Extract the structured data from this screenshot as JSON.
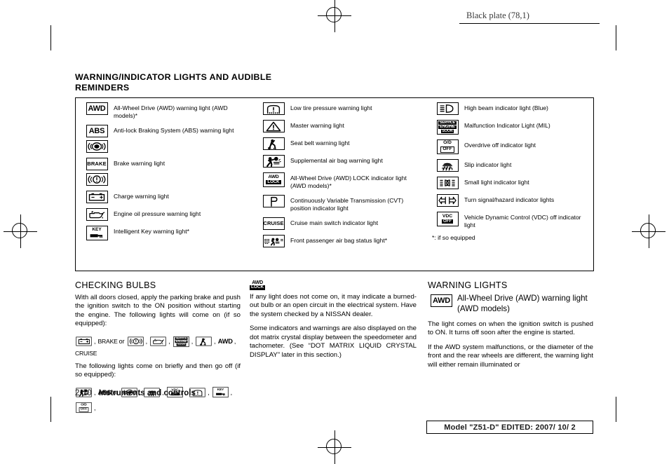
{
  "page": {
    "black_plate": "Black plate (78,1)",
    "model_footer": "Model \"Z51-D\"  EDITED:  2007/ 10/ 2",
    "page_number": "2-10",
    "section_name": "Instruments and controls",
    "title": "WARNING/INDICATOR LIGHTS AND AUDIBLE REMINDERS"
  },
  "indicator_table": {
    "footnote": "*: if so equipped",
    "columns": [
      {
        "rows": [
          {
            "icons": [
              "awd"
            ],
            "label": "All-Wheel Drive (AWD) warning light (AWD models)*"
          },
          {
            "icons": [
              "abs",
              "abs-circle"
            ],
            "label": "Anti-lock Braking System (ABS) warning light"
          },
          {
            "icons": [
              "brake",
              "brake-circle"
            ],
            "label": "Brake warning light"
          },
          {
            "icons": [
              "battery"
            ],
            "label": "Charge warning light"
          },
          {
            "icons": [
              "oil-can"
            ],
            "label": "Engine oil pressure warning light"
          },
          {
            "icons": [
              "key"
            ],
            "label": "Intelligent Key warning light*"
          }
        ]
      },
      {
        "rows": [
          {
            "icons": [
              "tire-pressure"
            ],
            "label": "Low tire pressure warning light"
          },
          {
            "icons": [
              "master-warning"
            ],
            "label": "Master warning light"
          },
          {
            "icons": [
              "seat-belt"
            ],
            "label": "Seat belt warning light"
          },
          {
            "icons": [
              "air-bag"
            ],
            "label": "Supplemental air bag warning light"
          },
          {
            "icons": [
              "awd-lock"
            ],
            "label": "All-Wheel Drive (AWD) LOCK indicator light (AWD models)*"
          },
          {
            "icons": [
              "cvt-p"
            ],
            "label": "Continuously Variable Transmission (CVT) position indicator light"
          },
          {
            "icons": [
              "cruise"
            ],
            "label": "Cruise main switch indicator light"
          },
          {
            "icons": [
              "passenger-airbag-status"
            ],
            "label": "Front passenger air bag status light*"
          }
        ]
      },
      {
        "rows": [
          {
            "icons": [
              "high-beam"
            ],
            "label": "High beam indicator light (Blue)"
          },
          {
            "icons": [
              "service-engine-soon"
            ],
            "label": "Malfunction Indicator Light (MIL)"
          },
          {
            "icons": [
              "od-off"
            ],
            "label": "Overdrive off indicator light"
          },
          {
            "icons": [
              "slip"
            ],
            "label": "Slip indicator light"
          },
          {
            "icons": [
              "small-light"
            ],
            "label": "Small light indicator light"
          },
          {
            "icons": [
              "turn-signal"
            ],
            "label": "Turn signal/hazard indicator lights"
          },
          {
            "icons": [
              "vdc-off"
            ],
            "label": "Vehicle Dynamic Control (VDC) off indicator light"
          }
        ]
      }
    ]
  },
  "checking_bulbs": {
    "heading": "CHECKING BULBS",
    "para1": "With all doors closed, apply the parking brake and push the ignition switch to the ON position without starting the engine. The following lights will come on (if so equipped):",
    "icon_row_1": [
      {
        "type": "icon",
        "name": "battery"
      },
      {
        "type": "sep",
        "text": ","
      },
      {
        "type": "word",
        "text": "BRAKE",
        "style": "thin"
      },
      {
        "type": "sep",
        "text": "or"
      },
      {
        "type": "icon",
        "name": "brake-circle"
      },
      {
        "type": "sep",
        "text": ","
      },
      {
        "type": "icon",
        "name": "oil-can"
      },
      {
        "type": "sep",
        "text": ","
      },
      {
        "type": "icon",
        "name": "service-engine-soon"
      },
      {
        "type": "sep",
        "text": ","
      },
      {
        "type": "icon",
        "name": "seat-belt"
      },
      {
        "type": "sep",
        "text": ","
      },
      {
        "type": "word",
        "text": "AWD",
        "style": "bold"
      },
      {
        "type": "sep",
        "text": ","
      },
      {
        "type": "word",
        "text": "CRUISE",
        "style": "thin"
      }
    ],
    "para2": "The following lights come on briefly and then go off (if so equipped):",
    "icon_row_2": [
      {
        "type": "icon",
        "name": "air-bag"
      },
      {
        "type": "sep",
        "text": ","
      },
      {
        "type": "word",
        "text": "ABS",
        "style": "bold"
      },
      {
        "type": "sep",
        "text": "or"
      },
      {
        "type": "icon",
        "name": "abs-circle"
      },
      {
        "type": "sep",
        "text": ","
      },
      {
        "type": "icon",
        "name": "slip"
      },
      {
        "type": "sep",
        "text": ","
      },
      {
        "type": "icon",
        "name": "vdc-off"
      },
      {
        "type": "sep",
        "text": ","
      },
      {
        "type": "icon",
        "name": "tire-pressure"
      },
      {
        "type": "sep",
        "text": ","
      },
      {
        "type": "icon",
        "name": "key"
      },
      {
        "type": "sep",
        "text": ","
      },
      {
        "type": "icon",
        "name": "od-off"
      },
      {
        "type": "sep",
        "text": ","
      }
    ]
  },
  "middle_column": {
    "para1": "If any light does not come on, it may indicate a burned-out bulb or an open circuit in the electrical system. Have the system checked by a NISSAN dealer.",
    "para2": "Some indicators and warnings are also displayed on the dot matrix crystal display between the speedometer and tachometer. (See “DOT MATRIX LIQUID CRYSTAL DISPLAY” later in this section.)"
  },
  "warning_lights": {
    "heading": "WARNING LIGHTS",
    "subheading": "All-Wheel Drive (AWD) warning light (AWD models)",
    "para1": "The light comes on when the ignition switch is pushed to ON. It turns off soon after the engine is started.",
    "para2": "If the AWD system malfunctions, or the diameter of the front and the rear wheels are different, the warning light will either remain illuminated or"
  },
  "icon_labels": {
    "awd": "AWD",
    "abs": "ABS",
    "brake": "BRAKE",
    "cruise": "CRUISE",
    "awd_lock_top": "AWD",
    "awd_lock_bottom": "LOCK",
    "ses_1": "SERVICE",
    "ses_2": "ENGINE",
    "ses_3": "SOON",
    "od_top": "O/D",
    "od_bottom": "OFF",
    "vdc_top": "VDC",
    "vdc_bottom": "OFF",
    "key": "KEY",
    "cvt_p": "P"
  }
}
